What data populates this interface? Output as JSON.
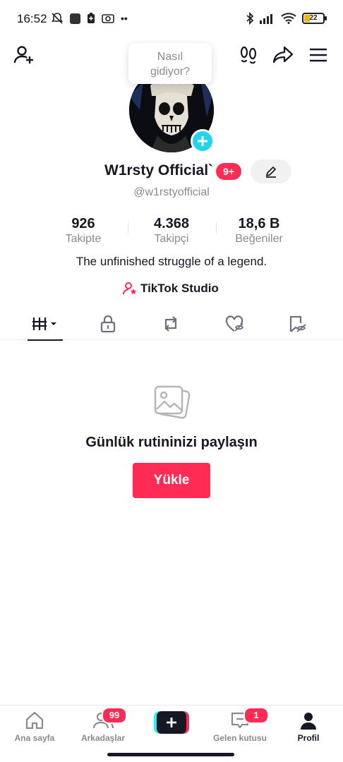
{
  "status_bar": {
    "time": "16:52",
    "battery": "22",
    "dots": "••"
  },
  "header": {
    "mood_bubble_line1": "Nasıl",
    "mood_bubble_line2": "gidiyor?"
  },
  "profile": {
    "display_name": "W1rsty Official`",
    "notification_badge": "9+",
    "username": "@w1rstyofficial",
    "stats": [
      {
        "value": "926",
        "label": "Takipte"
      },
      {
        "value": "4.368",
        "label": "Takipçi"
      },
      {
        "value": "18,6 B",
        "label": "Beğeniler"
      }
    ],
    "bio": "The unfinished struggle of a legend.",
    "studio_link": "TikTok Studio"
  },
  "tabs": [
    "videos-grid",
    "private",
    "reposts",
    "liked",
    "favorites"
  ],
  "empty_state": {
    "title": "Günlük rutininizi paylaşın",
    "button": "Yükle"
  },
  "bottom_nav": {
    "items": [
      {
        "label": "Ana sayfa"
      },
      {
        "label": "Arkadaşlar",
        "badge": "99"
      },
      {
        "label": ""
      },
      {
        "label": "Gelen kutusu",
        "badge": "1"
      },
      {
        "label": "Profil"
      }
    ]
  },
  "colors": {
    "accent": "#fe2c55",
    "cyan": "#20d5ec",
    "text": "#161823",
    "muted": "#8a8b91"
  }
}
